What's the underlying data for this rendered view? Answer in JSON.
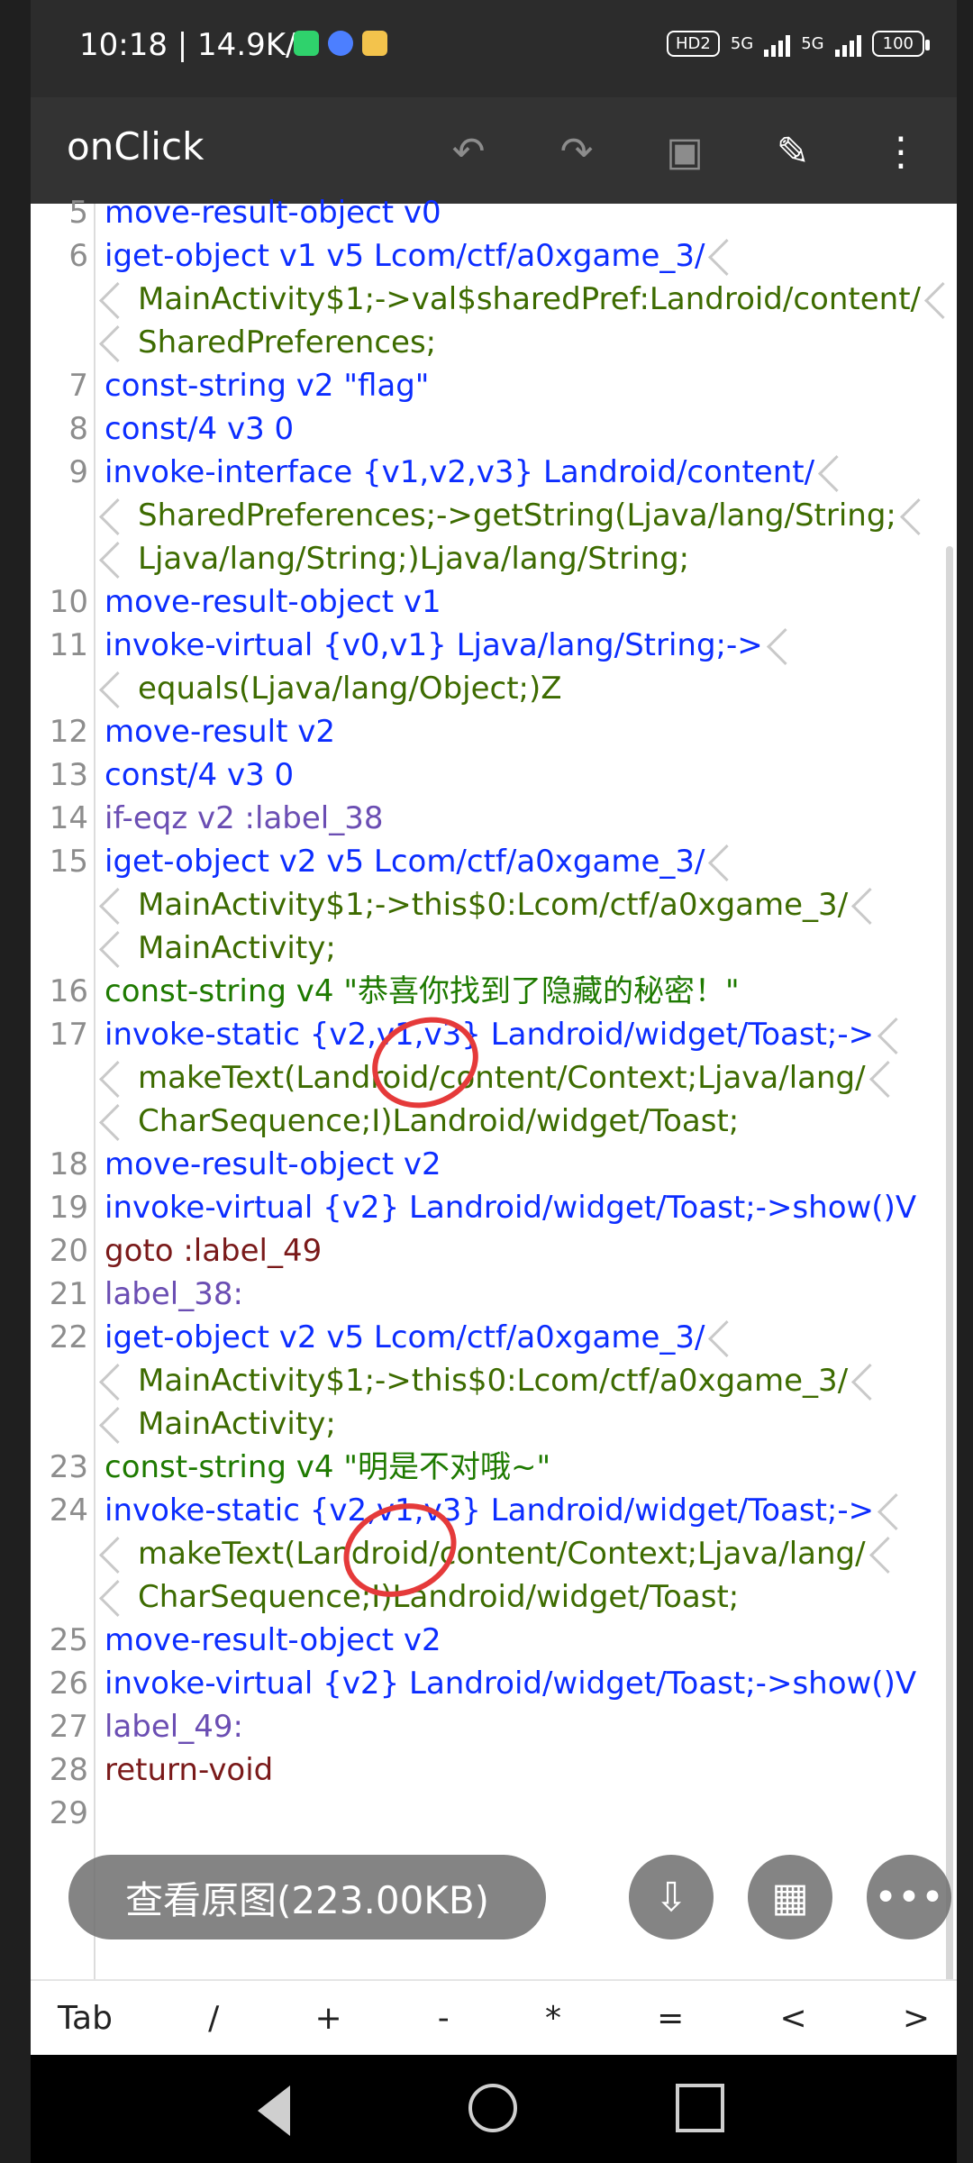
{
  "status": {
    "time": "10:18 | 14.9K/s",
    "hd": "HD2",
    "network1": "5G",
    "network2": "5G",
    "battery": "100"
  },
  "toolbar": {
    "title": "onClick",
    "undo_icon": "undo-icon",
    "redo_icon": "redo-icon",
    "save_icon": "save-icon",
    "edit_icon": "pencil-icon",
    "more_icon": "more-vertical-icon"
  },
  "code": {
    "lines": [
      {
        "num": "5",
        "text": "move-result-object v0"
      },
      {
        "num": "6",
        "text": "iget-object v1 v5 Lcom/ctf/a0xgame_3/"
      },
      {
        "num": "",
        "text": "MainActivity$1;->val$sharedPref:Landroid/content/"
      },
      {
        "num": "",
        "text": "SharedPreferences;"
      },
      {
        "num": "7",
        "text": "const-string v2 \"flag\""
      },
      {
        "num": "8",
        "text": "const/4 v3 0"
      },
      {
        "num": "9",
        "text": "invoke-interface {v1,v2,v3} Landroid/content/"
      },
      {
        "num": "",
        "text": "SharedPreferences;->getString(Ljava/lang/String;"
      },
      {
        "num": "",
        "text": "Ljava/lang/String;)Ljava/lang/String;"
      },
      {
        "num": "10",
        "text": "move-result-object v1"
      },
      {
        "num": "11",
        "text": "invoke-virtual {v0,v1} Ljava/lang/String;->"
      },
      {
        "num": "",
        "text": "equals(Ljava/lang/Object;)Z"
      },
      {
        "num": "12",
        "text": "move-result v2"
      },
      {
        "num": "13",
        "text": "const/4 v3 0"
      },
      {
        "num": "14",
        "text": "if-eqz v2 :label_38"
      },
      {
        "num": "15",
        "text": "iget-object v2 v5 Lcom/ctf/a0xgame_3/"
      },
      {
        "num": "",
        "text": "MainActivity$1;->this$0:Lcom/ctf/a0xgame_3/"
      },
      {
        "num": "",
        "text": "MainActivity;"
      },
      {
        "num": "16",
        "text": "const-string v4 \"恭喜你找到了隐藏的秘密！\""
      },
      {
        "num": "17",
        "text": "invoke-static {v2,v1,v3} Landroid/widget/Toast;->"
      },
      {
        "num": "",
        "text": "makeText(Landroid/content/Context;Ljava/lang/"
      },
      {
        "num": "",
        "text": "CharSequence;I)Landroid/widget/Toast;"
      },
      {
        "num": "18",
        "text": "move-result-object v2"
      },
      {
        "num": "19",
        "text": "invoke-virtual {v2} Landroid/widget/Toast;->show()V"
      },
      {
        "num": "20",
        "text": "goto :label_49"
      },
      {
        "num": "21",
        "text": "label_38:"
      },
      {
        "num": "22",
        "text": "iget-object v2 v5 Lcom/ctf/a0xgame_3/"
      },
      {
        "num": "",
        "text": "MainActivity$1;->this$0:Lcom/ctf/a0xgame_3/"
      },
      {
        "num": "",
        "text": "MainActivity;"
      },
      {
        "num": "23",
        "text": "const-string v4 \"明是不对哦~\""
      },
      {
        "num": "24",
        "text": "invoke-static {v2,v1,v3} Landroid/widget/Toast;->"
      },
      {
        "num": "",
        "text": "makeText(Landroid/content/Context;Ljava/lang/"
      },
      {
        "num": "",
        "text": "CharSequence;I)Landroid/widget/Toast;"
      },
      {
        "num": "25",
        "text": "move-result-object v2"
      },
      {
        "num": "26",
        "text": "invoke-virtual {v2} Landroid/widget/Toast;->show()V"
      },
      {
        "num": "27",
        "text": "label_49:"
      },
      {
        "num": "28",
        "text": "return-void"
      },
      {
        "num": "29",
        "text": ""
      }
    ]
  },
  "overlay": {
    "view_original": "查看原图(223.00KB)",
    "download_icon": "download-icon",
    "grid_icon": "grid-icon",
    "more_icon": "more-horizontal-icon"
  },
  "keybar": [
    "Tab",
    "/",
    "+",
    "-",
    "*",
    "=",
    "<",
    ">"
  ],
  "nav": {
    "back_icon": "back-triangle-icon",
    "home_icon": "home-circle-icon",
    "recent_icon": "recent-square-icon"
  }
}
